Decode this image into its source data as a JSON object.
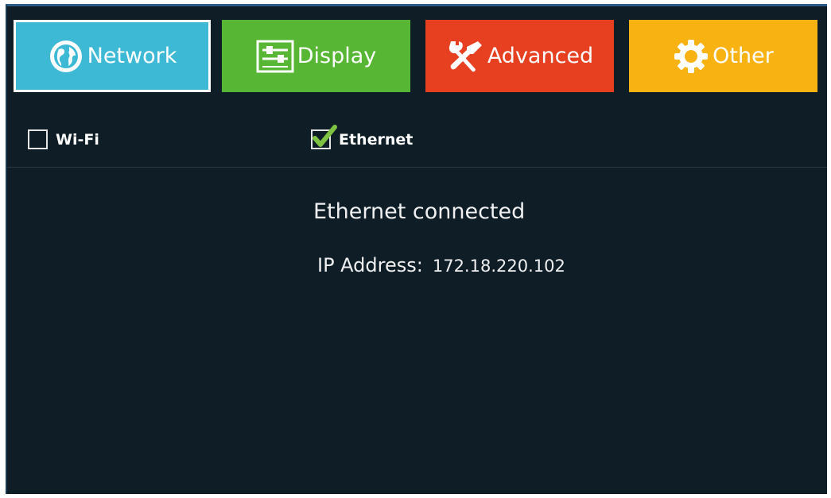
{
  "tabs": [
    {
      "label": "Network",
      "icon": "globe-icon",
      "color": "#3db9d6",
      "selected": true
    },
    {
      "label": "Display",
      "icon": "sliders-icon",
      "color": "#57b634",
      "selected": false
    },
    {
      "label": "Advanced",
      "icon": "wrench-screwdriver-icon",
      "color": "#e64020",
      "selected": false
    },
    {
      "label": "Other",
      "icon": "gear-icon",
      "color": "#f8b212",
      "selected": false
    }
  ],
  "options": {
    "wifi": {
      "label": "Wi-Fi",
      "checked": false
    },
    "ethernet": {
      "label": "Ethernet",
      "checked": true
    }
  },
  "status": {
    "text": "Ethernet connected",
    "ip_label": "IP Address:",
    "ip_value": "172.18.220.102"
  },
  "colors": {
    "background": "#0f1d26",
    "checkmark": "#7dc242"
  }
}
